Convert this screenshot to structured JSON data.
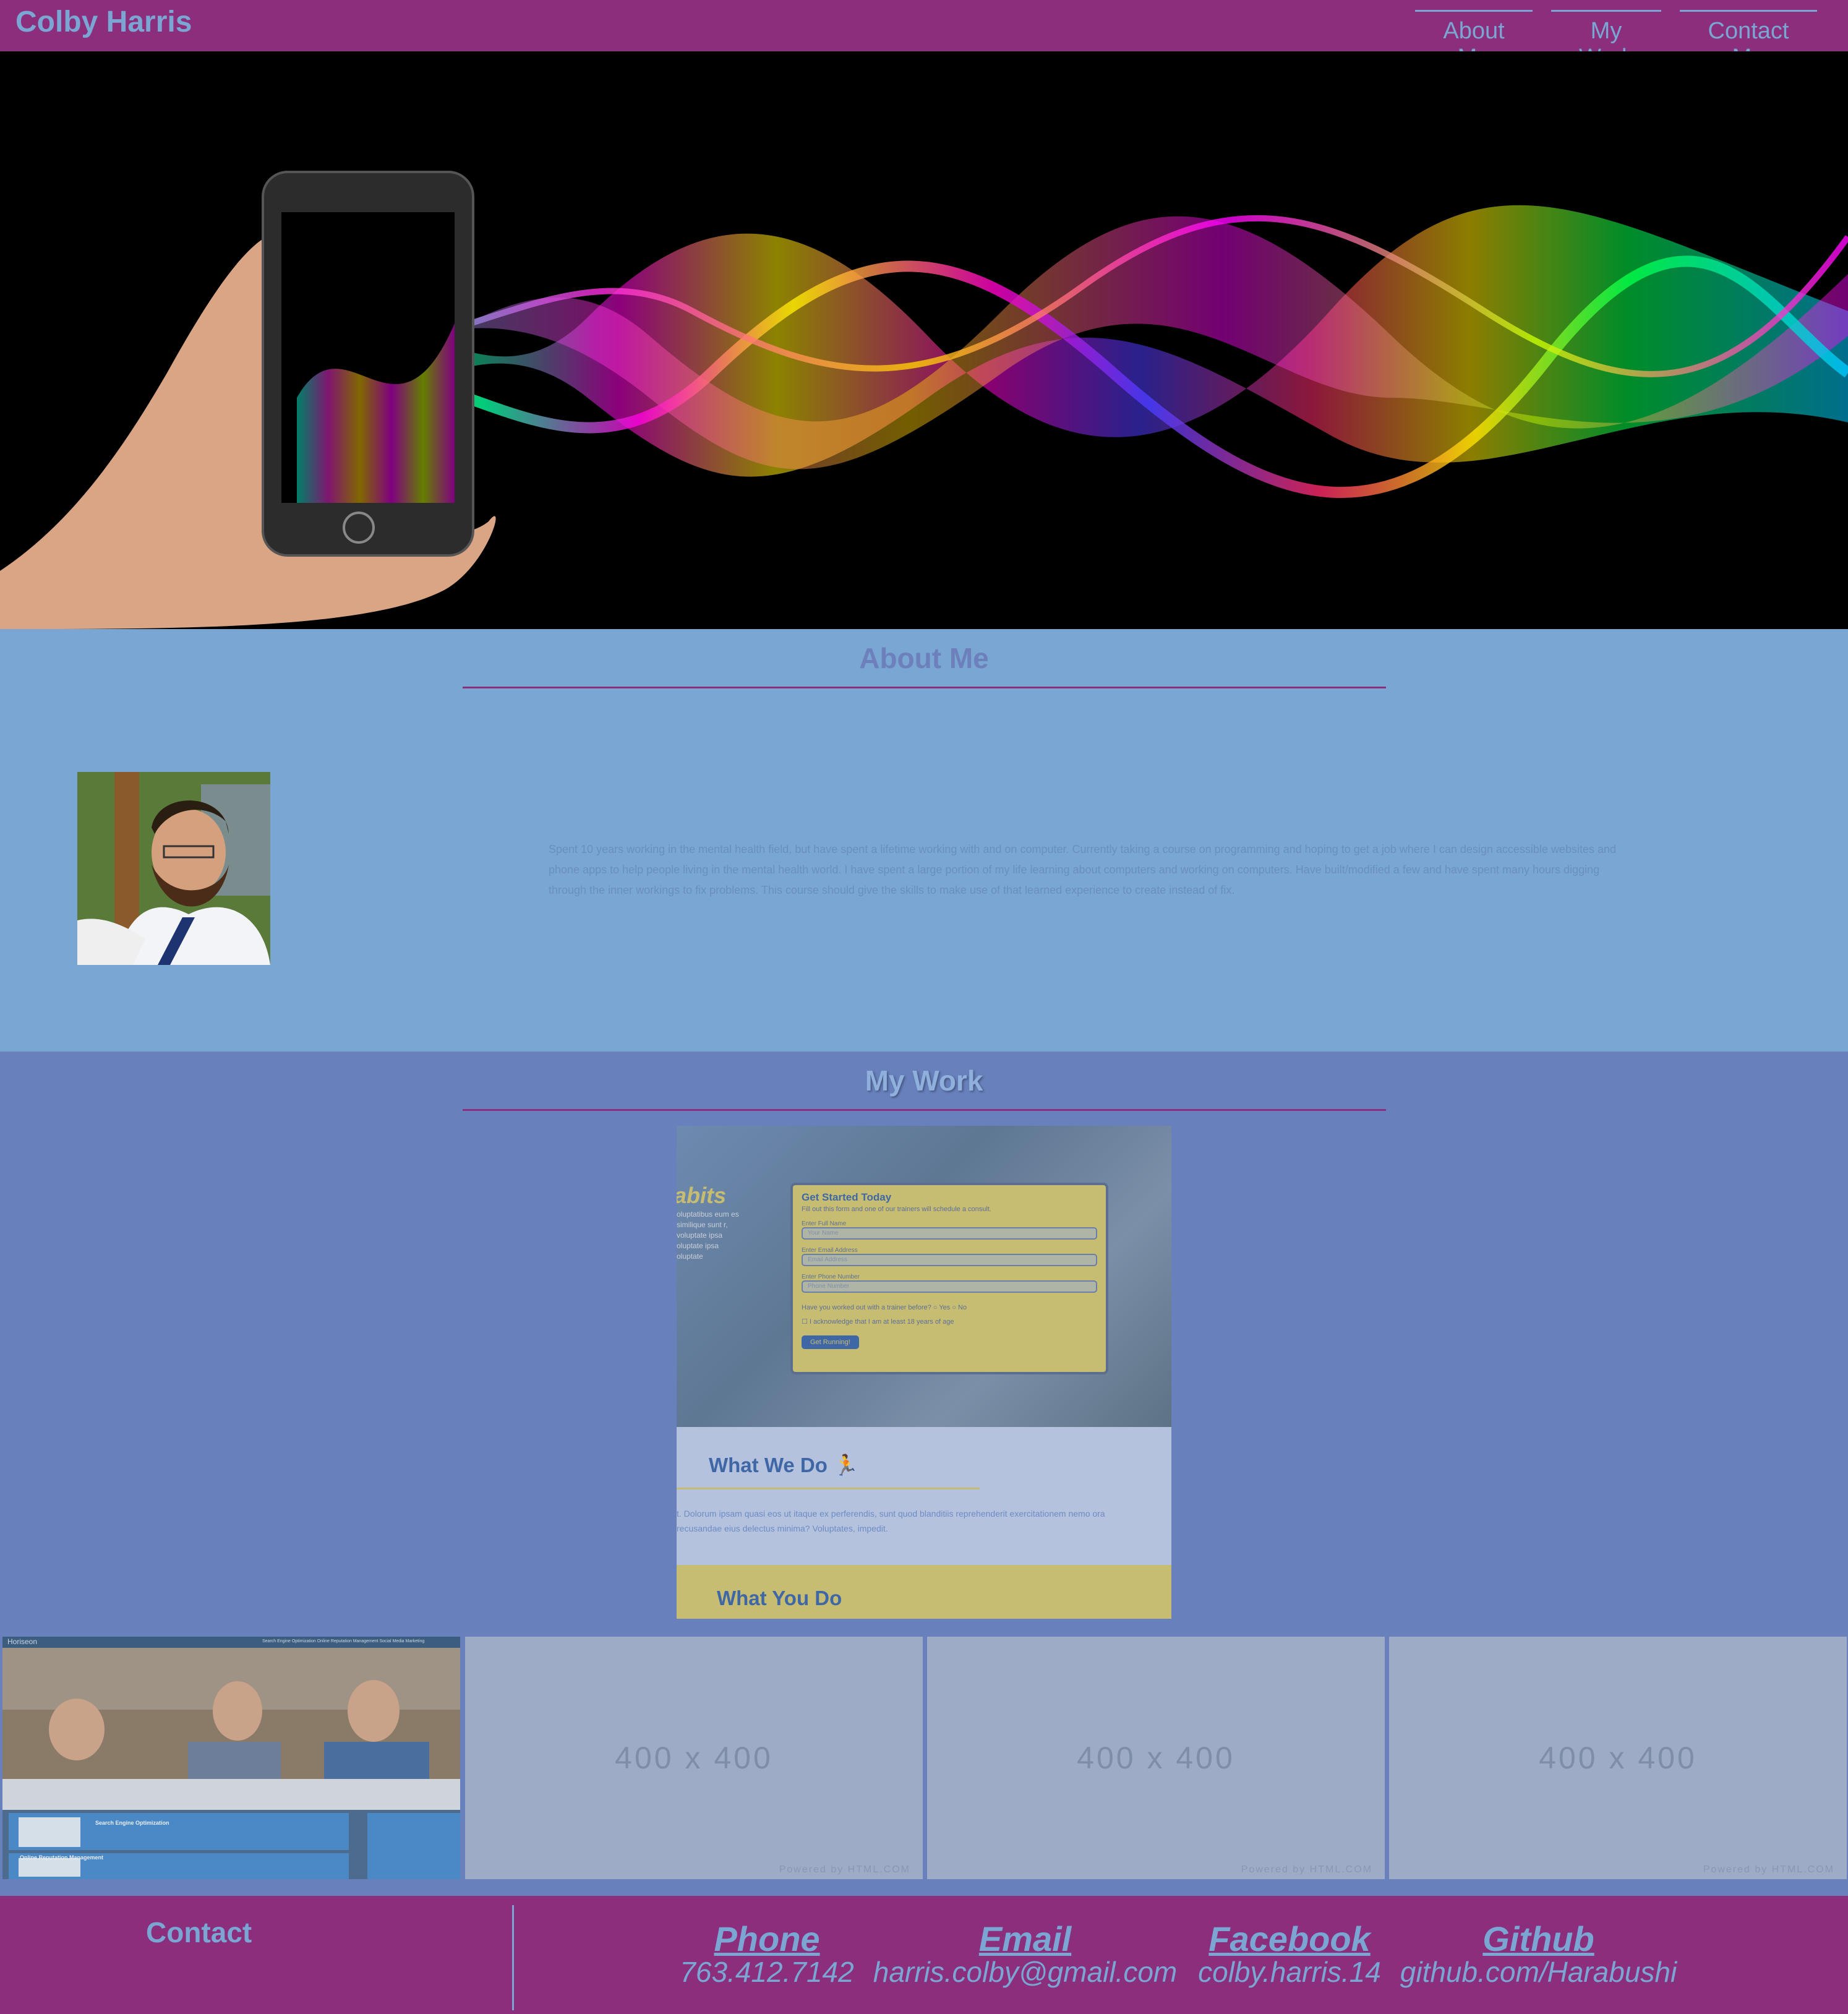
{
  "header": {
    "brand": "Colby Harris",
    "nav": [
      "About Me",
      "My Work",
      "Contact Me"
    ],
    "bg_color": "#8b2e7b",
    "link_color": "#7ba6d3"
  },
  "about": {
    "title": "About Me",
    "bio": "Spent 10 years working in the mental health field, but have spent a lifetime working with and on computer. Currently taking a course on programming and hoping to get a job where I can design accessible websites and phone apps to help people living in the mental health world. I have spent a large portion of my life learning about computers and working on computers. Have built/modified a few and have spent many hours digging through the inner workings to fix problems. This course should give the skills to make use of that learned experience to create instead of fix."
  },
  "work": {
    "title": "My Work",
    "featured": {
      "habits": "abits",
      "habits_text": "oluptatibus eum es similique sunt r, voluptate ipsa oluptate ipsa oluptate",
      "form_title": "Get Started Today",
      "form_subtitle": "Fill out this form and one of our trainers will schedule a consult.",
      "label_name": "Enter Full Name",
      "ph_name": "Your Name",
      "label_email": "Enter Email Address",
      "ph_email": "Email Address",
      "label_phone": "Enter Phone Number",
      "ph_phone": "Phone Number",
      "question": "Have you worked out with a trainer before?",
      "opt_yes": "Yes",
      "opt_no": "No",
      "ack": "I acknowledge that I am at least 18 years of age",
      "button": "Get Running!",
      "what_we_do": "What We Do",
      "what_we_do_text": "t. Dolorum ipsam quasi eos ut itaque ex perferendis, sunt quod blanditiis reprehenderit exercitationem nemo ora recusandae eius delectus minima? Voluptates, impedit.",
      "what_you_do": "What You Do"
    },
    "gallery": [
      {
        "kind": "screenshot",
        "site": "Horiseon",
        "nav": "Search Engine Optimization   Online Reputation Management   Social Media Marketing",
        "s1": "Search Engine Optimization",
        "s2": "Online Reputation Management"
      },
      {
        "kind": "placeholder",
        "label": "400 x 400",
        "powered": "Powered by HTML.COM"
      },
      {
        "kind": "placeholder",
        "label": "400 x 400",
        "powered": "Powered by HTML.COM"
      },
      {
        "kind": "placeholder",
        "label": "400 x 400",
        "powered": "Powered by HTML.COM"
      }
    ]
  },
  "footer": {
    "title": "Contact",
    "contacts": [
      {
        "label": "Phone",
        "value": "763.412.7142"
      },
      {
        "label": "Email",
        "value": "harris.colby@gmail.com"
      },
      {
        "label": "Facebook",
        "value": "colby.harris.14"
      },
      {
        "label": "Github",
        "value": "github.com/Harabushi"
      }
    ]
  }
}
